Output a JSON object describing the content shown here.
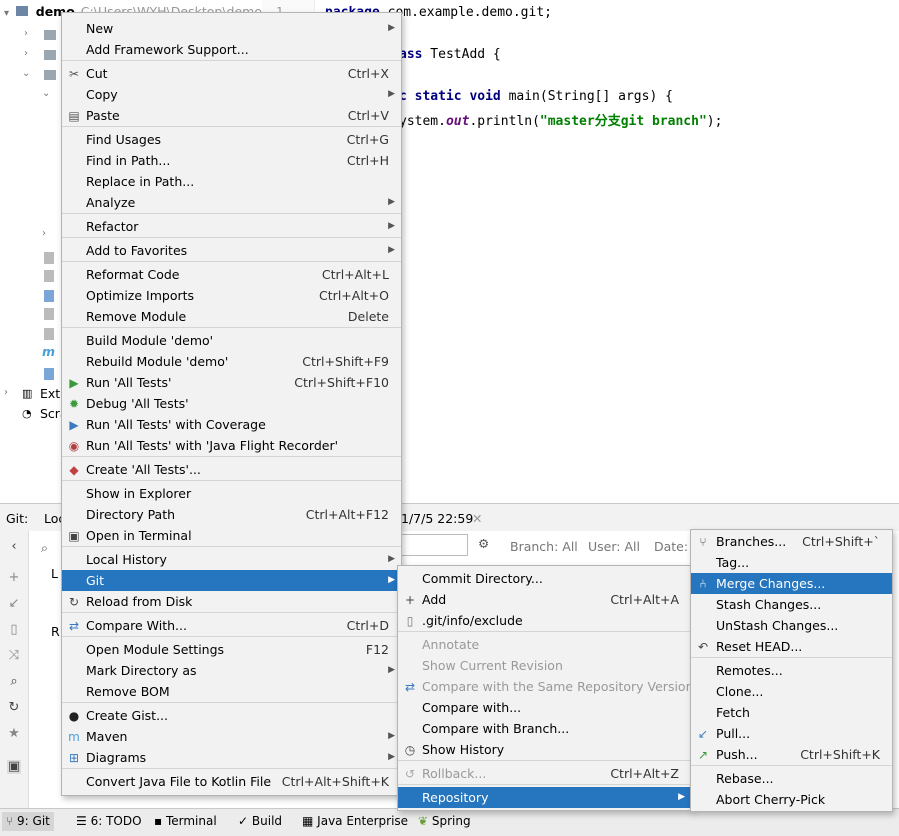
{
  "project": {
    "root_name": "demo",
    "root_path": "C:\\Users\\WYH\\Desktop\\demo",
    "external_label": "Exte",
    "scratches_label": "Scra"
  },
  "editor": {
    "line_number": "1",
    "lines": [
      {
        "pre": "",
        "kw": "package",
        "rest": " com.example.demo.git;"
      },
      {
        "pre": "",
        "kw": "ass",
        "rest": " TestAdd {"
      },
      {
        "pre": "",
        "kw": "c static void",
        "rest": " main(String[] args) {"
      },
      {
        "pre": "ystem.",
        "fld": "out",
        "mid": ".println(",
        "str": "\"master分支git branch\"",
        "post": ");"
      }
    ]
  },
  "git_panel": {
    "tab_label": "Git:",
    "local_label": "Loc",
    "timestamp": "1/7/5 22:59",
    "filter_branch": "Branch: All",
    "filter_user": "User: All",
    "filter_date": "Date: A",
    "tree_label_l": "L",
    "tree_label_r": "R"
  },
  "bottom_tabs": [
    {
      "label": "9: Git",
      "active": true
    },
    {
      "label": "6: TODO"
    },
    {
      "label": "Terminal"
    },
    {
      "label": "Build"
    },
    {
      "label": "Java Enterprise"
    },
    {
      "label": "Spring"
    }
  ],
  "context_menu": {
    "items": [
      {
        "label": "New",
        "sub": true
      },
      {
        "label": "Add Framework Support..."
      },
      {
        "label": "Cut",
        "sc": "Ctrl+X",
        "icon": "scissors"
      },
      {
        "label": "Copy",
        "sub": true
      },
      {
        "label": "Paste",
        "sc": "Ctrl+V",
        "icon": "paste"
      },
      {
        "label": "Find Usages",
        "sc": "Ctrl+G"
      },
      {
        "label": "Find in Path...",
        "sc": "Ctrl+H"
      },
      {
        "label": "Replace in Path..."
      },
      {
        "label": "Analyze",
        "sub": true
      },
      {
        "label": "Refactor",
        "sub": true
      },
      {
        "label": "Add to Favorites",
        "sub": true
      },
      {
        "label": "Reformat Code",
        "sc": "Ctrl+Alt+L"
      },
      {
        "label": "Optimize Imports",
        "sc": "Ctrl+Alt+O"
      },
      {
        "label": "Remove Module",
        "sc": "Delete"
      },
      {
        "label": "Build Module 'demo'"
      },
      {
        "label": "Rebuild Module 'demo'",
        "sc": "Ctrl+Shift+F9"
      },
      {
        "label": "Run 'All Tests'",
        "sc": "Ctrl+Shift+F10",
        "icon": "run"
      },
      {
        "label": "Debug 'All Tests'",
        "icon": "debug"
      },
      {
        "label": "Run 'All Tests' with Coverage",
        "icon": "coverage"
      },
      {
        "label": "Run 'All Tests' with 'Java Flight Recorder'",
        "icon": "jfr"
      },
      {
        "label": "Create 'All Tests'...",
        "icon": "create-test"
      },
      {
        "label": "Show in Explorer"
      },
      {
        "label": "Directory Path",
        "sc": "Ctrl+Alt+F12"
      },
      {
        "label": "Open in Terminal",
        "icon": "terminal"
      },
      {
        "label": "Local History",
        "sub": true
      },
      {
        "label": "Git",
        "sub": true,
        "selected": true
      },
      {
        "label": "Reload from Disk",
        "icon": "reload"
      },
      {
        "label": "Compare With...",
        "sc": "Ctrl+D",
        "icon": "compare"
      },
      {
        "label": "Open Module Settings",
        "sc": "F12"
      },
      {
        "label": "Mark Directory as",
        "sub": true
      },
      {
        "label": "Remove BOM"
      },
      {
        "label": "Create Gist...",
        "icon": "github"
      },
      {
        "label": "Maven",
        "sub": true,
        "icon": "maven"
      },
      {
        "label": "Diagrams",
        "sub": true,
        "icon": "diagram"
      },
      {
        "label": "Convert Java File to Kotlin File",
        "sc": "Ctrl+Alt+Shift+K"
      }
    ]
  },
  "git_menu": {
    "items": [
      {
        "label": "Commit Directory..."
      },
      {
        "label": "Add",
        "sc": "Ctrl+Alt+A",
        "icon": "plus"
      },
      {
        "label": ".git/info/exclude",
        "icon": "file"
      },
      {
        "label": "Annotate",
        "disabled": true
      },
      {
        "label": "Show Current Revision",
        "disabled": true
      },
      {
        "label": "Compare with the Same Repository Version",
        "disabled": true,
        "icon": "compare"
      },
      {
        "label": "Compare with..."
      },
      {
        "label": "Compare with Branch..."
      },
      {
        "label": "Show History",
        "icon": "clock"
      },
      {
        "label": "Rollback...",
        "sc": "Ctrl+Alt+Z",
        "disabled": true,
        "icon": "rollback"
      },
      {
        "label": "Repository",
        "sub": true,
        "selected": true
      }
    ]
  },
  "repo_menu": {
    "items": [
      {
        "label": "Branches...",
        "sc": "Ctrl+Shift+`",
        "icon": "branch"
      },
      {
        "label": "Tag..."
      },
      {
        "label": "Merge Changes...",
        "selected": true,
        "icon": "merge"
      },
      {
        "label": "Stash Changes..."
      },
      {
        "label": "UnStash Changes..."
      },
      {
        "label": "Reset HEAD...",
        "icon": "reset"
      },
      {
        "label": "Remotes..."
      },
      {
        "label": "Clone..."
      },
      {
        "label": "Fetch"
      },
      {
        "label": "Pull...",
        "icon": "pull"
      },
      {
        "label": "Push...",
        "sc": "Ctrl+Shift+K",
        "icon": "push"
      },
      {
        "label": "Rebase..."
      },
      {
        "label": "Abort Cherry-Pick"
      }
    ]
  },
  "colors": {
    "selection": "#2675bf",
    "menu_bg": "#f2f2f2",
    "keyword": "#000080",
    "string": "#008000"
  }
}
